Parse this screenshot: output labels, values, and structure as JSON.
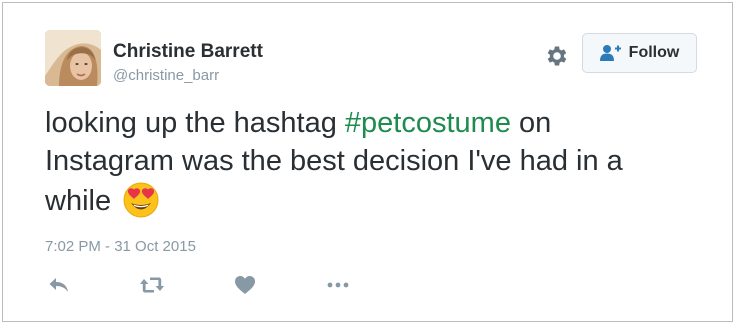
{
  "author": {
    "name": "Christine Barrett",
    "handle": "@christine_barr"
  },
  "header": {
    "gear_icon": "gear-icon",
    "follow_label": "Follow",
    "follow_icon": "add-user-icon"
  },
  "tweet": {
    "text_before": "looking up the hashtag ",
    "hashtag": "#petcostume",
    "text_after": " on Instagram was the best decision I've had in a while",
    "emoji": "heart-eyes-emoji"
  },
  "timestamp": "7:02 PM - 31 Oct 2015",
  "actions": [
    "reply-icon",
    "retweet-icon",
    "like-icon",
    "more-icon"
  ],
  "colors": {
    "hashtag": "#1e8c4e",
    "text": "#292f33",
    "muted": "#8899a6",
    "follow_icon": "#2b7bb9"
  }
}
